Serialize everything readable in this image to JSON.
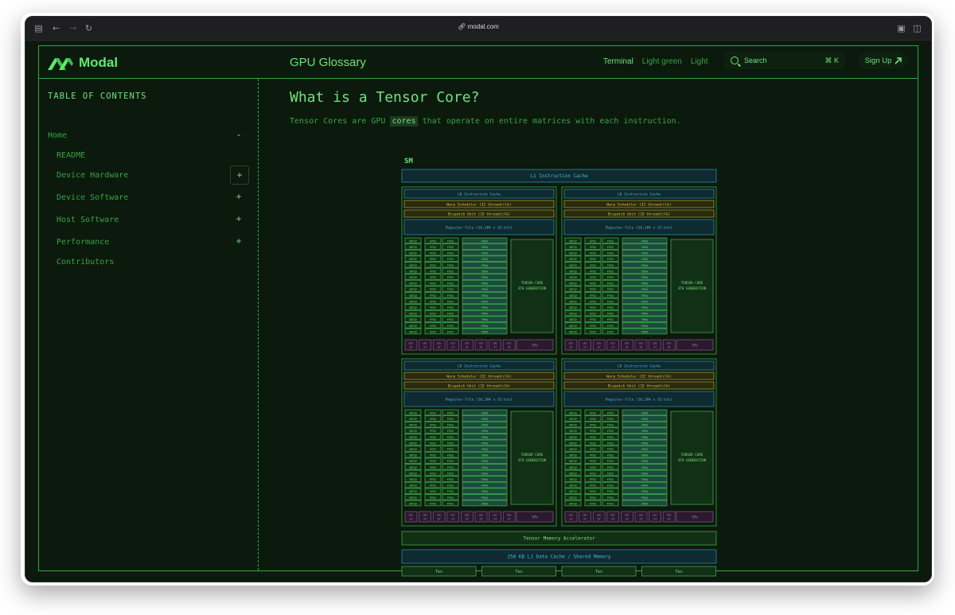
{
  "browser": {
    "url": "modal.com"
  },
  "header": {
    "brand": "Modal",
    "title": "GPU Glossary",
    "themes": [
      "Terminal",
      "Light green",
      "Light"
    ],
    "search_label": "Search",
    "search_shortcut": "⌘ K",
    "signup_label": "Sign Up",
    "signup_icon": "arrow-up-right-icon"
  },
  "sidebar": {
    "heading": "TABLE OF CONTENTS",
    "items": [
      {
        "label": "Home",
        "toggle": "-"
      },
      {
        "label": "README",
        "toggle": ""
      },
      {
        "label": "Device Hardware",
        "toggle": "+"
      },
      {
        "label": "Device Software",
        "toggle": "+"
      },
      {
        "label": "Host Software",
        "toggle": "+"
      },
      {
        "label": "Performance",
        "toggle": "+"
      },
      {
        "label": "Contributors",
        "toggle": ""
      }
    ]
  },
  "article": {
    "title": "What is a Tensor Core?",
    "intro_before": "Tensor Cores are GPU",
    "intro_highlight": "cores",
    "intro_after": "that operate on entire matrices with each instruction."
  },
  "diagram": {
    "label": "SM",
    "l1_instruction_cache": "L1 Instruction Cache",
    "l0_instruction_cache": "L0 Instruction Cache",
    "warp_scheduler": "Warp Scheduler (32 thread/clk)",
    "dispatch_unit": "Dispatch Unit (32 thread/clk)",
    "register_file": "Register File (16,384 x 32-bit)",
    "int32": "INT32",
    "fp32": "FP32",
    "fp64": "FP64",
    "tensor_core": [
      "TENSOR CORE",
      "4TH GENERATION"
    ],
    "ldst": [
      "LD/",
      "ST"
    ],
    "sfu": "SFU",
    "tensor_memory_accelerator": "Tensor Memory Accelerator",
    "l1_data_cache": "256 KB L1 Data Cache / Shared Memory",
    "tex": [
      "Tex",
      "Tex",
      "Tex",
      "Tex"
    ],
    "colors": {
      "cyan_border": "#2a8aa5",
      "cyan_fill": "#0f2a30",
      "cyan_text": "#4cb8d6",
      "yellow_border": "#a89a2c",
      "yellow_fill": "#2a2a10",
      "yellow_text": "#d4c34a",
      "green_border": "#3aa84a",
      "green_fill": "#123016",
      "green_text": "#6fe27b",
      "teal_fill": "#1c4a3c",
      "purple_border": "#8a4a8e",
      "purple_fill": "#2a1a2c",
      "purple_text": "#c07ac8"
    }
  }
}
